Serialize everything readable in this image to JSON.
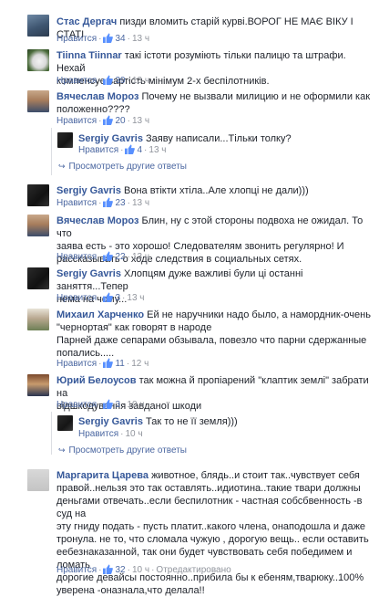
{
  "ui": {
    "like_label": "Нравится",
    "view_replies_label": "Просмотреть другие ответы",
    "edited_label": "Отредактировано"
  },
  "comments": [
    {
      "name": "Стас Дергач",
      "text": "пизди вломить старій курві.ВОРОГ НЕ МАЄ ВІКУ І СТАТІ",
      "likes": "34",
      "time": "13 ч"
    },
    {
      "name": "Tiinna Tiinnar",
      "text_lines": [
        "такі істоти розуміють тільки палицю та штрафи. Нехай",
        "компенсує вартість мінімум 2-х беспілотників."
      ],
      "likes": "39",
      "time": "13 ч"
    },
    {
      "name": "Вячеслав Мороз",
      "text_lines": [
        "Почему не вызвали милицию и не оформили как",
        "положенно????"
      ],
      "likes": "20",
      "time": "13 ч"
    },
    {
      "name": "Sergiy Gavris",
      "text": "Заяву написали...Тільки толку?",
      "likes": "4",
      "time": "13 ч"
    },
    {
      "name": "Sergiy Gavris",
      "text": "Вона втікти хтіла..Але хлопці не дали)))",
      "likes": "23",
      "time": "13 ч"
    },
    {
      "name": "Вячеслав Мороз",
      "text_lines": [
        "Блин, ну с этой стороны подвоха не ожидал. То что",
        "заява есть - это хорошо! Следователям звонить регулярно! И",
        "рассказывать о ходе следствия в социальных сетях."
      ],
      "likes": "22",
      "time": "13 ч"
    },
    {
      "name": "Sergiy Gavris",
      "text_lines": [
        "Хлопцям дуже важливі були ці останні заняття...Тепер",
        "нема на чому..."
      ],
      "likes": "3",
      "time": "13 ч"
    },
    {
      "name": "Михаил Харченко",
      "text_lines": [
        "Ей не наручники надо было, а намордник-очень",
        "\"чернортая\" как говорят в народе",
        "Парней даже сепарами обзывала, повезло что парни сдержанные",
        "попались....."
      ],
      "likes": "11",
      "time": "12 ч"
    },
    {
      "name": "Юрий Белоусов",
      "text_lines": [
        "так можна й пропіарений \"клаптик землі\" забрати на",
        "відшкодування завданої шкоди"
      ],
      "likes": "3",
      "time": "10 ч"
    },
    {
      "name": "Sergiy Gavris",
      "text": "Так то не її земля)))",
      "time": "10 ч"
    },
    {
      "name": "Маргарита Царева",
      "text_lines": [
        "животное, блядь..и стоит так..чувствует себя",
        "правой..нельзя это так оставлять..идиотина..такие твари должны",
        "деньгами отвечать..если беспилотник - частная собсбвенность -в суд на",
        "эту гниду подать - пусть платит..какого члена, онаподошла и даже",
        "тронула. не то, что сломала чужую , дорогую вещь.. если оставить",
        "еебезнаказанной, так они будет чувствовать себя победимем и ломать",
        "дорогие девайсы постоянно..прибила бы к ебеням,тварюку..100%",
        "уверена -оназнала,что делала!!"
      ],
      "likes": "32",
      "time": "10 ч"
    }
  ]
}
